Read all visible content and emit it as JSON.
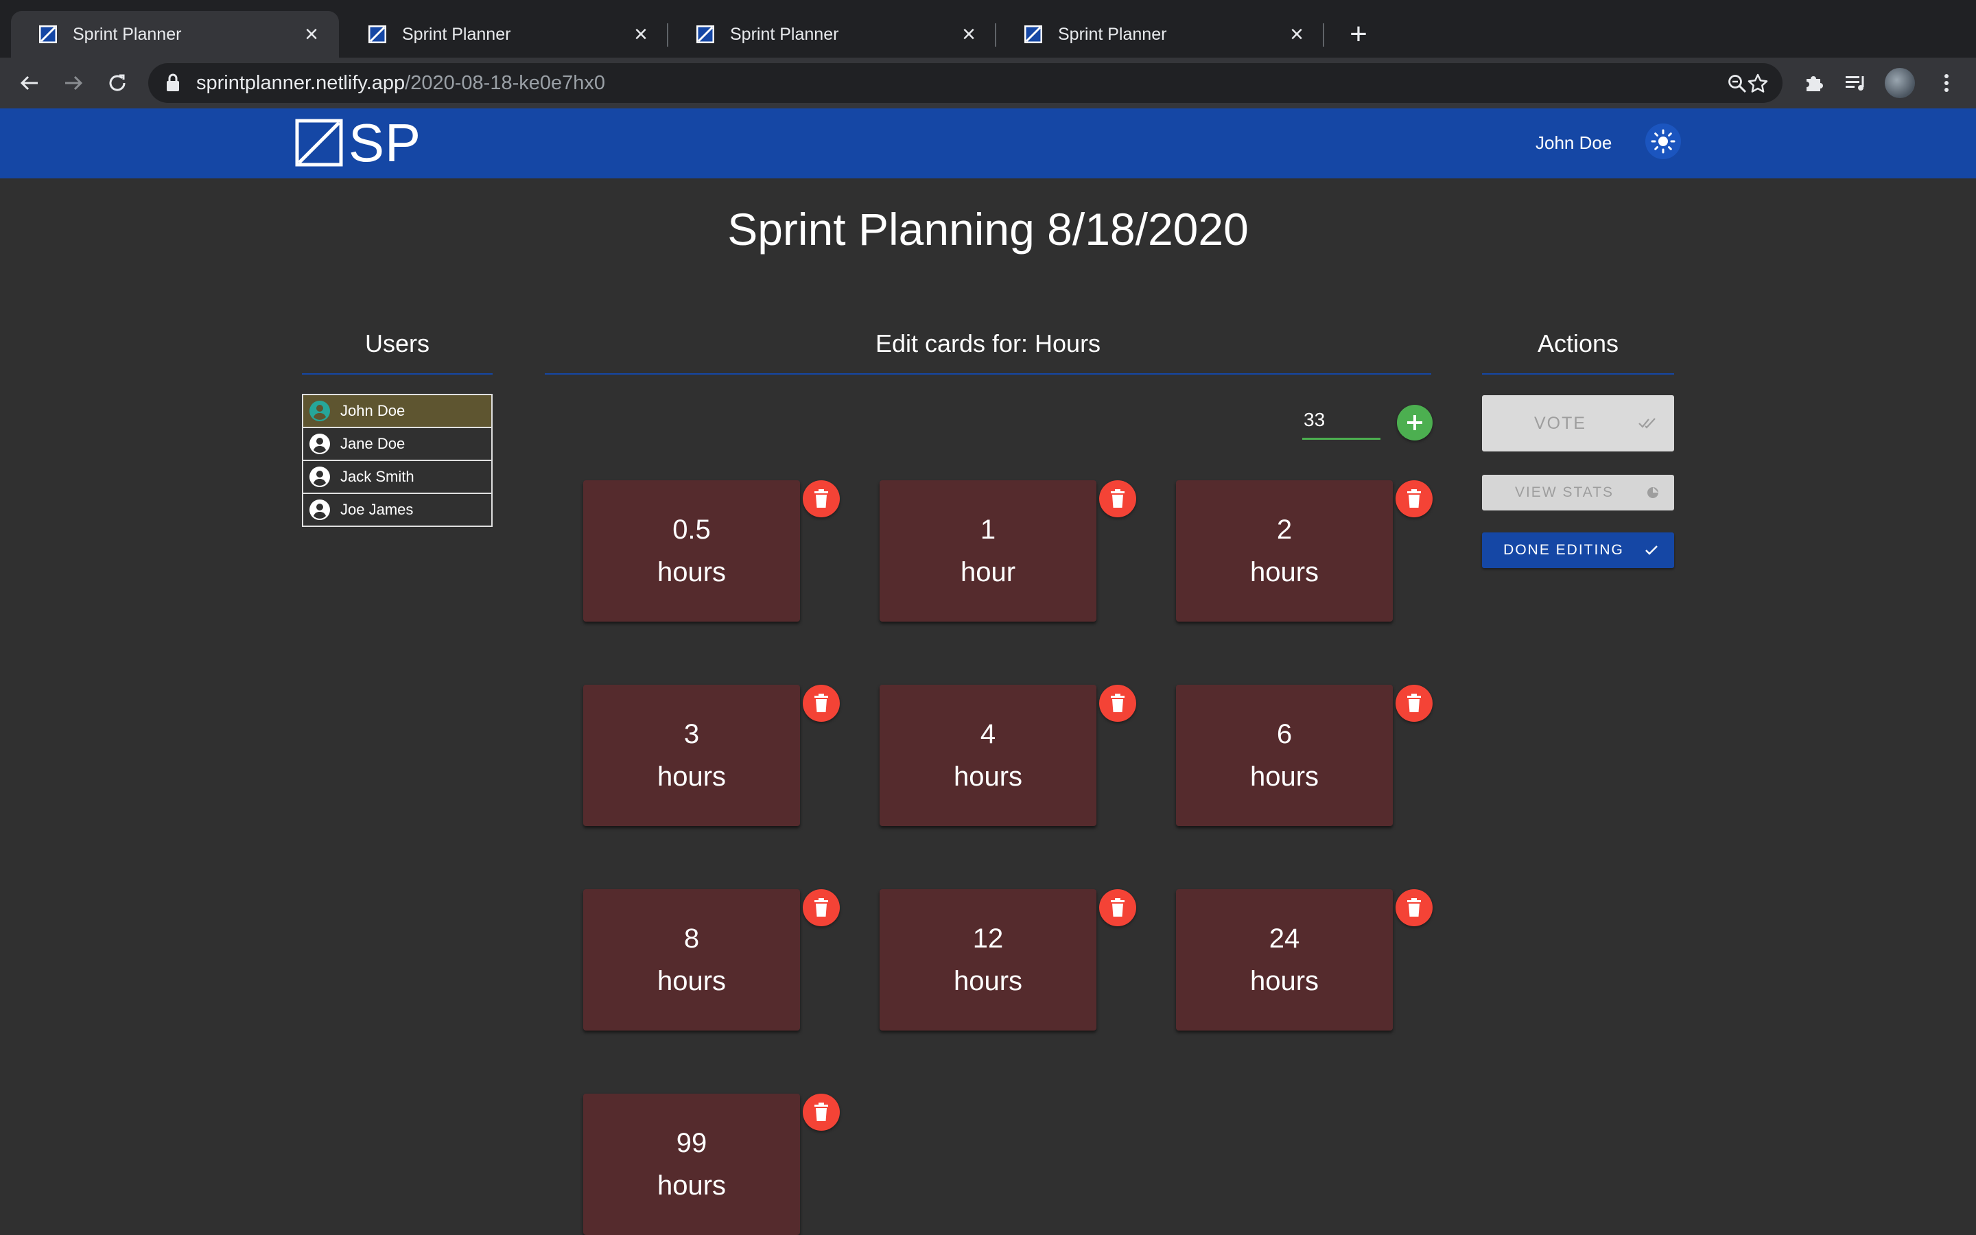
{
  "browser": {
    "tabs": [
      {
        "title": "Sprint Planner",
        "active": true
      },
      {
        "title": "Sprint Planner",
        "active": false
      },
      {
        "title": "Sprint Planner",
        "active": false
      },
      {
        "title": "Sprint Planner",
        "active": false
      }
    ],
    "url_host": "sprintplanner.netlify.app",
    "url_path": "/2020-08-18-ke0e7hx0"
  },
  "header": {
    "logo_text": "SP",
    "username": "John Doe",
    "brand_color": "#1547a5"
  },
  "page": {
    "title": "Sprint Planning 8/18/2020"
  },
  "users": {
    "heading": "Users",
    "items": [
      {
        "name": "John Doe",
        "current": true
      },
      {
        "name": "Jane Doe",
        "current": false
      },
      {
        "name": "Jack Smith",
        "current": false
      },
      {
        "name": "Joe James",
        "current": false
      }
    ]
  },
  "cards": {
    "heading": "Edit cards for: Hours",
    "new_card_value": "33",
    "items": [
      {
        "value": "0.5",
        "unit": "hours"
      },
      {
        "value": "1",
        "unit": "hour"
      },
      {
        "value": "2",
        "unit": "hours"
      },
      {
        "value": "3",
        "unit": "hours"
      },
      {
        "value": "4",
        "unit": "hours"
      },
      {
        "value": "6",
        "unit": "hours"
      },
      {
        "value": "8",
        "unit": "hours"
      },
      {
        "value": "12",
        "unit": "hours"
      },
      {
        "value": "24",
        "unit": "hours"
      },
      {
        "value": "99",
        "unit": "hours"
      }
    ],
    "card_color": "#552b2d",
    "delete_color": "#f44336",
    "add_color": "#4caf50"
  },
  "actions": {
    "heading": "Actions",
    "vote_label": "VOTE",
    "view_stats_label": "VIEW STATS",
    "done_editing_label": "DONE EDITING"
  }
}
